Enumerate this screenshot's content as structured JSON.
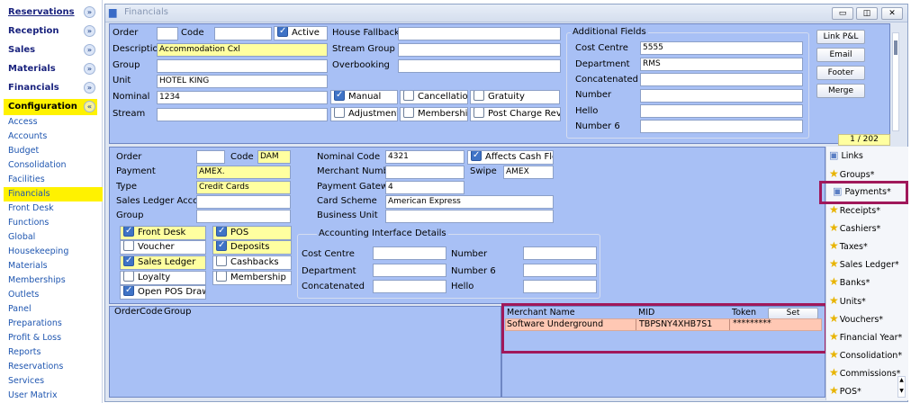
{
  "sidebar": {
    "sections": [
      {
        "label": "Reservations",
        "chevron": "chevron-down-icon"
      },
      {
        "label": "Reception",
        "chevron": "chevron-down-icon"
      },
      {
        "label": "Sales",
        "chevron": "chevron-down-icon"
      },
      {
        "label": "Materials",
        "chevron": "chevron-down-icon"
      },
      {
        "label": "Financials",
        "chevron": "chevron-down-icon"
      },
      {
        "label": "Configuration",
        "chevron": "chevron-up-icon"
      }
    ],
    "items": [
      "Access",
      "Accounts",
      "Budget",
      "Consolidation",
      "Facilities",
      "Financials",
      "Front Desk",
      "Functions",
      "Global",
      "Housekeeping",
      "Materials",
      "Memberships",
      "Outlets",
      "Panel",
      "Preparations",
      "Profit & Loss",
      "Reports",
      "Reservations",
      "Services",
      "User Matrix"
    ],
    "selected_item": "Financials"
  },
  "window": {
    "title": "Financials",
    "controls": {
      "minimize": "minimize-icon",
      "restore": "restore-icon",
      "close": "close-icon"
    }
  },
  "top": {
    "order_label": "Order",
    "order_value": "",
    "code_label": "Code",
    "code_value": "",
    "active_label": "Active",
    "active_checked": true,
    "description_label": "Description",
    "description_value": "Accommodation Cxl",
    "group_label": "Group",
    "group_value": "",
    "unit_label": "Unit",
    "unit_value": "HOTEL KING",
    "nominal_label": "Nominal",
    "nominal_value": "1234",
    "stream_label": "Stream",
    "stream_value": "",
    "house_fallback_label": "House Fallback",
    "stream_group_label": "Stream Group",
    "overbooking_label": "Overbooking",
    "checks": [
      {
        "label": "Manual",
        "checked": true
      },
      {
        "label": "Cancellation",
        "checked": false
      },
      {
        "label": "Gratuity",
        "checked": false
      },
      {
        "label": "Adjustment",
        "checked": false
      },
      {
        "label": "Membership",
        "checked": false
      },
      {
        "label": "Post Charge Revenue",
        "checked": false
      }
    ],
    "additional_fields": {
      "legend": "Additional Fields",
      "rows": [
        {
          "label": "Cost Centre",
          "value": "5555"
        },
        {
          "label": "Department",
          "value": "RMS"
        },
        {
          "label": "Concatenated",
          "value": ""
        },
        {
          "label": "Number",
          "value": ""
        },
        {
          "label": "Hello",
          "value": ""
        },
        {
          "label": "Number 6",
          "value": ""
        }
      ]
    },
    "buttons": [
      "Link P&L",
      "Email",
      "Footer",
      "Merge"
    ],
    "record_counter": "1 / 202"
  },
  "payment": {
    "order_label": "Order",
    "order_value": "",
    "code_label": "Code",
    "code_value": "DAM",
    "payment_label": "Payment",
    "payment_value": "AMEX.",
    "type_label": "Type",
    "type_value": "Credit Cards",
    "sales_ledger_account_label": "Sales Ledger Account",
    "sales_ledger_account_value": "",
    "group_label": "Group",
    "group_value": "",
    "nominal_code_label": "Nominal Code",
    "nominal_code_value": "4321",
    "affects_cash_flow_label": "Affects Cash Flow",
    "affects_cash_flow_checked": true,
    "merchant_number_label": "Merchant Number",
    "merchant_number_value": "",
    "swipe_label": "Swipe",
    "swipe_value": "AMEX",
    "payment_gateway_label": "Payment Gateway",
    "payment_gateway_value": "4",
    "card_scheme_label": "Card Scheme",
    "card_scheme_value": "American Express",
    "business_unit_label": "Business Unit",
    "business_unit_value": "",
    "checks": [
      {
        "label": "Front Desk",
        "checked": true,
        "highlight": true
      },
      {
        "label": "POS",
        "checked": true,
        "highlight": true
      },
      {
        "label": "Voucher",
        "checked": false,
        "highlight": false
      },
      {
        "label": "Deposits",
        "checked": true,
        "highlight": true
      },
      {
        "label": "Sales Ledger",
        "checked": true,
        "highlight": true
      },
      {
        "label": "Cashbacks",
        "checked": false,
        "highlight": false
      },
      {
        "label": "Loyalty",
        "checked": false,
        "highlight": false
      },
      {
        "label": "Membership",
        "checked": false,
        "highlight": false
      },
      {
        "label": "Open POS Drawer",
        "checked": true,
        "highlight": false
      }
    ],
    "accounting": {
      "legend": "Accounting Interface Details",
      "left": [
        {
          "label": "Cost Centre",
          "value": ""
        },
        {
          "label": "Department",
          "value": ""
        },
        {
          "label": "Concatenated",
          "value": ""
        }
      ],
      "right": [
        {
          "label": "Number",
          "value": ""
        },
        {
          "label": "Number 6",
          "value": ""
        },
        {
          "label": "Hello",
          "value": ""
        }
      ]
    }
  },
  "bottom": {
    "grid_headers": [
      "Order",
      "Code",
      "Group"
    ],
    "merchant_headers": [
      "Merchant Name",
      "MID",
      "Token"
    ],
    "set_label": "Set",
    "merchant_row": {
      "name": "Software Underground",
      "mid": "TBPSNY4XHB7S1",
      "token": "*********"
    }
  },
  "right_links": [
    "Links",
    "Groups*",
    "Payments*",
    "Receipts*",
    "Cashiers*",
    "Taxes*",
    "Sales Ledger*",
    "Banks*",
    "Units*",
    "Vouchers*",
    "Financial Year*",
    "Consolidation*",
    "Commissions*",
    "POS*"
  ],
  "colors": {
    "panel": "#a8c0f5",
    "highlight_border": "#a0185a",
    "selected_nav": "#fff200",
    "merchant_row": "#ffc8b4"
  }
}
